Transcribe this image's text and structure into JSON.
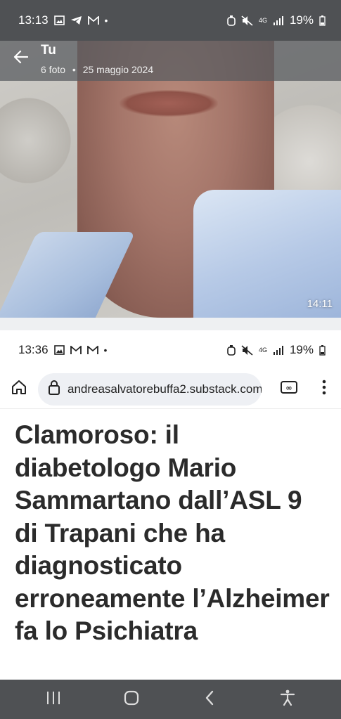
{
  "status_top": {
    "time": "13:13",
    "network": "4G",
    "battery": "19%"
  },
  "viewer": {
    "title": "Tu",
    "photo_count": "6 foto",
    "separator_dot": "•",
    "date": "25 maggio 2024",
    "photo_time": "14:11"
  },
  "status_inner": {
    "time": "13:36",
    "network": "4G",
    "battery": "19%"
  },
  "browser": {
    "url": "andreasalvatorebuffa2.substack.com"
  },
  "article": {
    "title": "Clamoroso: il diabetologo Mario Sammartano dall’ASL 9 di Trapani che ha diagnosticato erroneamente l’Alzheimer fa lo Psichiatra"
  },
  "icons": {
    "back": "back-arrow-icon",
    "home": "home-icon",
    "lock": "lock-icon",
    "tabs": "tabs-icon",
    "menu": "more-vert-icon",
    "recents": "recents-icon",
    "home_nav": "home-nav-icon",
    "back_nav": "back-nav-icon",
    "accessibility": "accessibility-icon"
  }
}
